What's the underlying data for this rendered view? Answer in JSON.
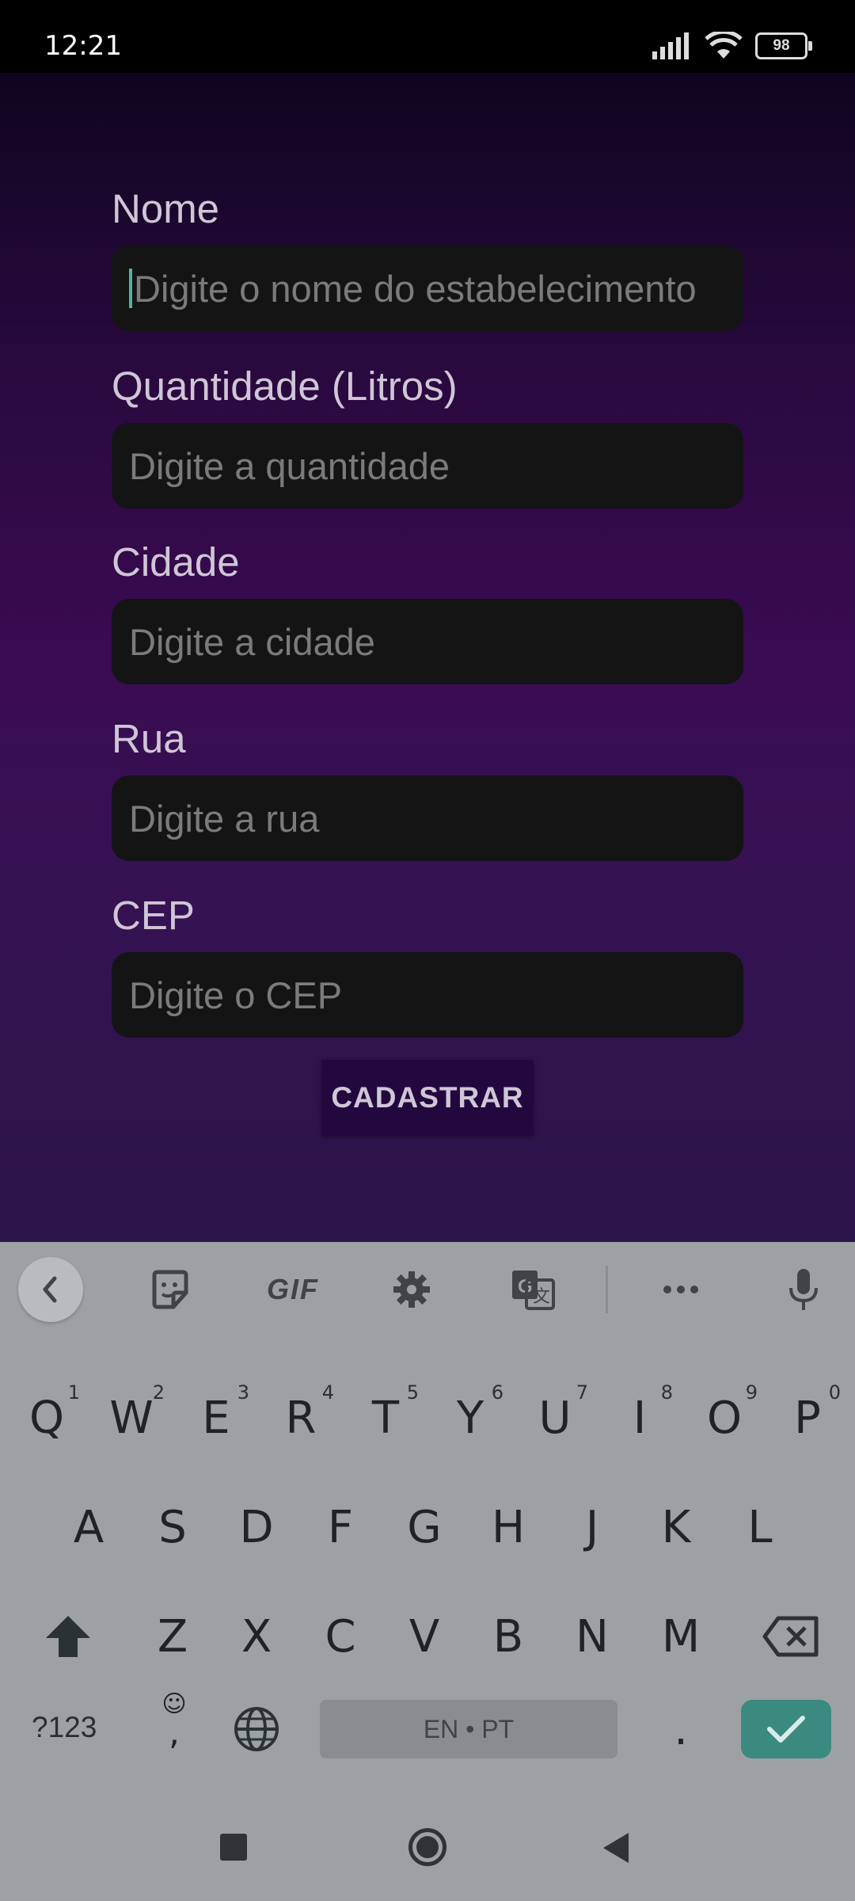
{
  "status_bar": {
    "time": "12:21",
    "battery": "98"
  },
  "form": {
    "fields": [
      {
        "label": "Nome",
        "placeholder": "Digite o nome do estabelecimento"
      },
      {
        "label": "Quantidade (Litros)",
        "placeholder": "Digite a quantidade"
      },
      {
        "label": "Cidade",
        "placeholder": "Digite a cidade"
      },
      {
        "label": "Rua",
        "placeholder": "Digite a rua"
      },
      {
        "label": "CEP",
        "placeholder": "Digite o CEP"
      }
    ],
    "submit_label": "CADASTRAR"
  },
  "keyboard": {
    "toolbar": [
      "back-icon",
      "sticker-icon",
      "GIF",
      "gear-icon",
      "translate-icon",
      "more-icon",
      "mic-icon"
    ],
    "gif_label": "GIF",
    "row1": [
      {
        "k": "Q",
        "h": "1"
      },
      {
        "k": "W",
        "h": "2"
      },
      {
        "k": "E",
        "h": "3"
      },
      {
        "k": "R",
        "h": "4"
      },
      {
        "k": "T",
        "h": "5"
      },
      {
        "k": "Y",
        "h": "6"
      },
      {
        "k": "U",
        "h": "7"
      },
      {
        "k": "I",
        "h": "8"
      },
      {
        "k": "O",
        "h": "9"
      },
      {
        "k": "P",
        "h": "0"
      }
    ],
    "row2": [
      "A",
      "S",
      "D",
      "F",
      "G",
      "H",
      "J",
      "K",
      "L"
    ],
    "row3": [
      "Z",
      "X",
      "C",
      "V",
      "B",
      "N",
      "M"
    ],
    "symbols_label": "?123",
    "comma_label": ",",
    "period_label": ".",
    "space_label": "EN • PT"
  }
}
